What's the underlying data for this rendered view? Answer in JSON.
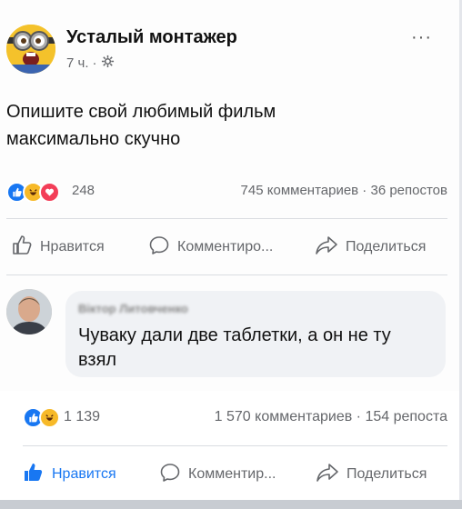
{
  "post": {
    "author": "Усталый монтажер",
    "time": "7 ч.",
    "separator": "·",
    "more": "···",
    "text": "Опишите свой любимый фильм максимально скучно",
    "reaction_count": "248",
    "comments_shares": "745 комментариев · 36 репостов",
    "actions": {
      "like": "Нравится",
      "comment": "Комментиро...",
      "share": "Поделиться"
    }
  },
  "comment": {
    "author": "Віктор Литовченко",
    "text": "Чуваку дали две таблетки, а он не ту взял"
  },
  "outer": {
    "reaction_count": "1 139",
    "comments_shares": "1 570 комментариев · 154 репоста",
    "actions": {
      "like": "Нравится",
      "comment": "Комментир...",
      "share": "Поделиться"
    }
  },
  "icons": {
    "like": "like-icon",
    "haha": "haha-icon",
    "love": "love-icon",
    "globe": "globe-icon"
  },
  "colors": {
    "like_blue": "#1877f2",
    "haha_yellow": "#f7b928",
    "love_red": "#f33e58",
    "secondary_text": "#65676b"
  }
}
